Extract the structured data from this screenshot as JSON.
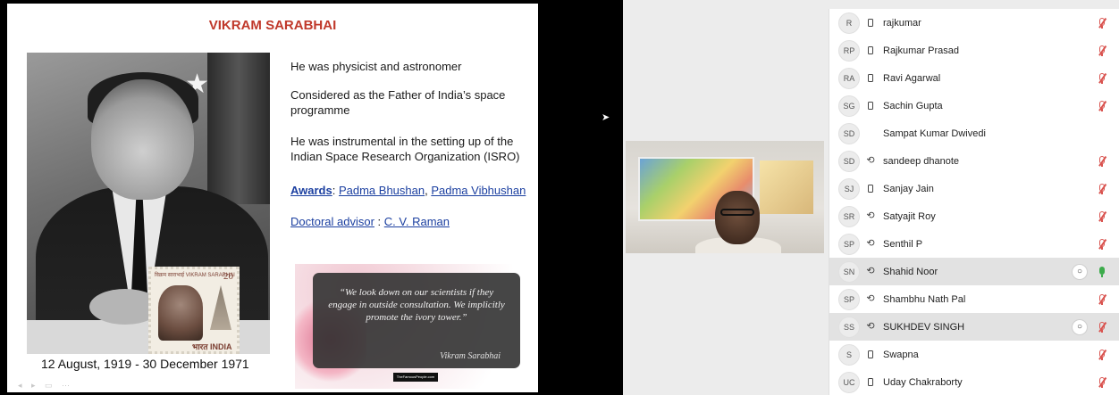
{
  "slide": {
    "title": "VIKRAM SARABHAI",
    "facts": [
      "He was physicist and astronomer",
      "Considered as the Father of India’s space programme",
      "He was instrumental in the setting up of the Indian Space Research Organization (ISRO)"
    ],
    "awards_label": "Awards",
    "award_1": "Padma Bhushan",
    "award_2": "Padma Vibhushan",
    "advisor_label": "Doctoral advisor",
    "advisor_name": "C. V. Raman",
    "dates": "12 August, 1919 - 30 December 1971",
    "stamp_value": "20",
    "stamp_country": "भारत INDIA",
    "stamp_top_text": "विक्रम साराभाई VIKRAM SARABHAI",
    "quote": "“We look down on our scientists if they engage in outside consultation. We implicitly promote the ivory tower.”",
    "quote_author": "Vikram Sarabhai",
    "quote_credit": "TheFamousPeople.com"
  },
  "participants": [
    {
      "initials": "R",
      "name": "rajkumar",
      "device": "phone",
      "mic": "off",
      "chat": false,
      "active": false
    },
    {
      "initials": "RP",
      "name": "Rajkumar Prasad",
      "device": "phone",
      "mic": "off",
      "chat": false,
      "active": false
    },
    {
      "initials": "RA",
      "name": "Ravi Agarwal",
      "device": "phone",
      "mic": "off",
      "chat": false,
      "active": false
    },
    {
      "initials": "SG",
      "name": "Sachin Gupta",
      "device": "phone",
      "mic": "off",
      "chat": false,
      "active": false
    },
    {
      "initials": "SD",
      "name": "Sampat Kumar Dwivedi",
      "device": "none",
      "mic": "none",
      "chat": false,
      "active": false
    },
    {
      "initials": "SD",
      "name": "sandeep dhanote",
      "device": "web",
      "mic": "off",
      "chat": false,
      "active": false
    },
    {
      "initials": "SJ",
      "name": "Sanjay Jain",
      "device": "phone",
      "mic": "off",
      "chat": false,
      "active": false
    },
    {
      "initials": "SR",
      "name": "Satyajit Roy",
      "device": "web",
      "mic": "off",
      "chat": false,
      "active": false
    },
    {
      "initials": "SP",
      "name": "Senthil P",
      "device": "web",
      "mic": "off",
      "chat": false,
      "active": false
    },
    {
      "initials": "SN",
      "name": "Shahid Noor",
      "device": "web",
      "mic": "on",
      "chat": true,
      "active": true
    },
    {
      "initials": "SP",
      "name": "Shambhu Nath Pal",
      "device": "web",
      "mic": "off",
      "chat": false,
      "active": false
    },
    {
      "initials": "SS",
      "name": "SUKHDEV SINGH",
      "device": "web",
      "mic": "off",
      "chat": true,
      "active": true
    },
    {
      "initials": "S",
      "name": "Swapna",
      "device": "phone",
      "mic": "off",
      "chat": false,
      "active": false
    },
    {
      "initials": "UC",
      "name": "Uday Chakraborty",
      "device": "phone",
      "mic": "off",
      "chat": false,
      "active": false
    }
  ]
}
